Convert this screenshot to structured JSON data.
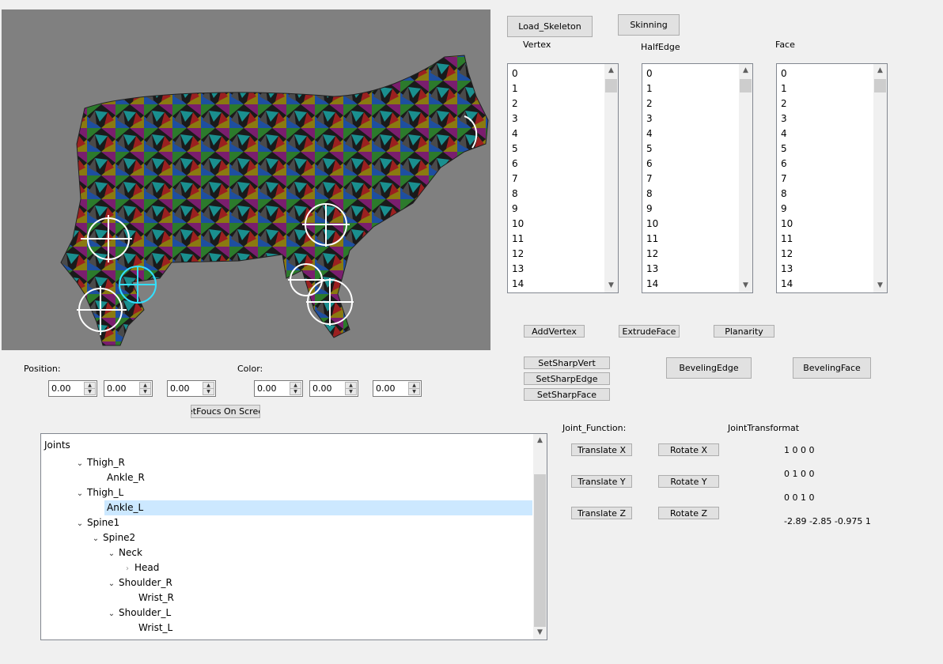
{
  "top_buttons": {
    "load_skeleton": "Load_Skeleton",
    "skinning": "Skinning"
  },
  "lists": {
    "vertex": {
      "title": "Vertex",
      "items": [
        "0",
        "1",
        "2",
        "3",
        "4",
        "5",
        "6",
        "7",
        "8",
        "9",
        "10",
        "11",
        "12",
        "13",
        "14"
      ]
    },
    "halfedge": {
      "title": "HalfEdge",
      "items": [
        "0",
        "1",
        "2",
        "3",
        "4",
        "5",
        "6",
        "7",
        "8",
        "9",
        "10",
        "11",
        "12",
        "13",
        "14"
      ]
    },
    "face": {
      "title": "Face",
      "items": [
        "0",
        "1",
        "2",
        "3",
        "4",
        "5",
        "6",
        "7",
        "8",
        "9",
        "10",
        "11",
        "12",
        "13",
        "14"
      ]
    }
  },
  "ops": {
    "add_vertex": "AddVertex",
    "extrude_face": "ExtrudeFace",
    "planarity": "Planarity",
    "set_sharp_vert": "SetSharpVert",
    "set_sharp_edge": "SetSharpEdge",
    "set_sharp_face": "SetSharpFace",
    "beveling_edge": "BevelingEdge",
    "beveling_face": "BevelingFace"
  },
  "position": {
    "label": "Position:",
    "values": [
      "0.00",
      "0.00",
      "0.00"
    ]
  },
  "color": {
    "label": "Color:",
    "values": [
      "0.00",
      "0.00",
      "0.00"
    ]
  },
  "set_focus_button": "etFoucs On Scree",
  "joints": {
    "root": "Joints",
    "nodes": [
      {
        "label": "Thigh_R",
        "expanded": true
      },
      {
        "label": "Ankle_R"
      },
      {
        "label": "Thigh_L",
        "expanded": true
      },
      {
        "label": "Ankle_L",
        "selected": true
      },
      {
        "label": "Spine1",
        "expanded": true
      },
      {
        "label": "Spine2",
        "expanded": true
      },
      {
        "label": "Neck",
        "expanded": true
      },
      {
        "label": "Head",
        "expanded": false
      },
      {
        "label": "Shoulder_R",
        "expanded": true
      },
      {
        "label": "Wrist_R"
      },
      {
        "label": "Shoulder_L",
        "expanded": true
      },
      {
        "label": "Wrist_L"
      }
    ]
  },
  "joint_function": {
    "label": "Joint_Function:",
    "translate_x": "Translate  X",
    "translate_y": "Translate  Y",
    "translate_z": "Translate  Z",
    "rotate_x": "Rotate  X",
    "rotate_y": "Rotate  Y",
    "rotate_z": "Rotate  Z"
  },
  "joint_transform": {
    "label": "JointTransformat",
    "rows": [
      "1  0  0  0",
      "0  1  0  0",
      "0  0  1  0",
      "-2.89  -2.85  -0.975  1"
    ]
  },
  "colors": {
    "viewport_bg": "#808080",
    "selection": "#cce8ff"
  }
}
